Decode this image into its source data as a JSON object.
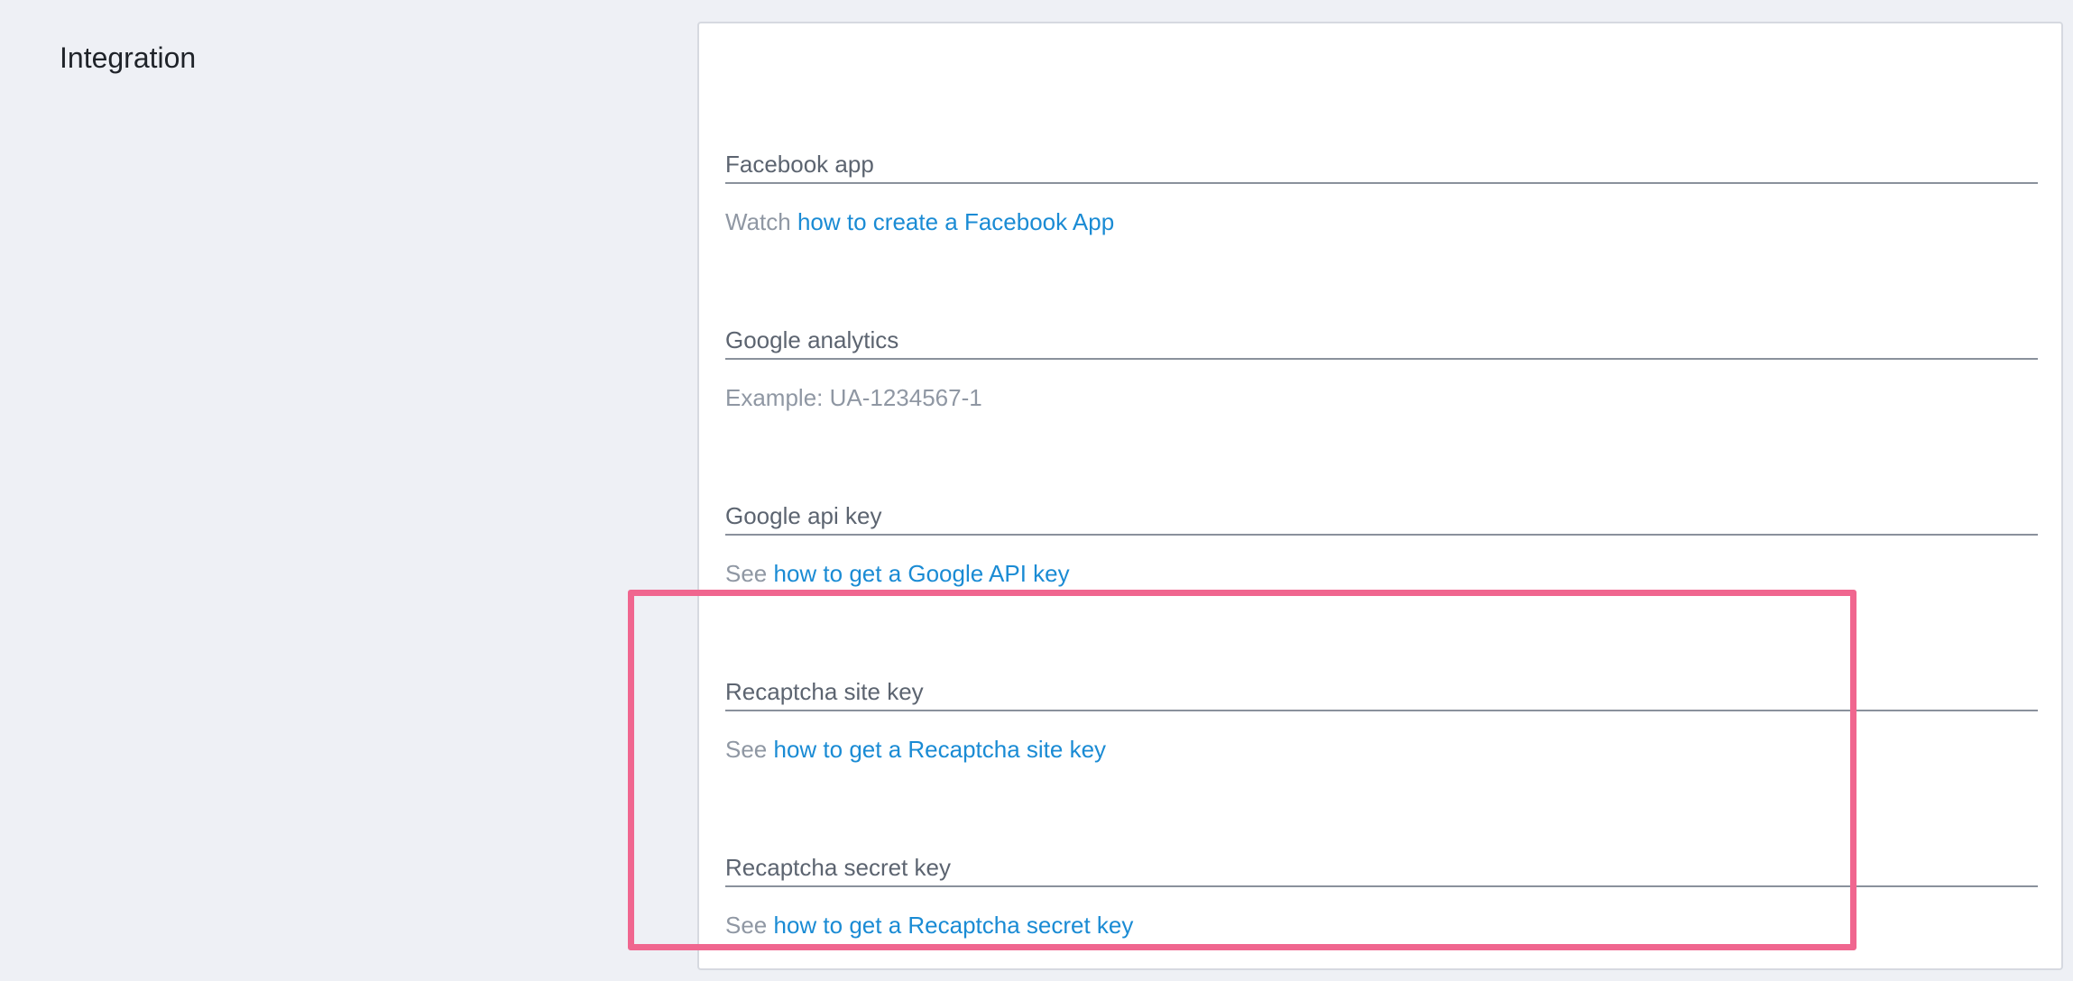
{
  "section": {
    "title": "Integration"
  },
  "fields": [
    {
      "label": "Facebook app",
      "help_prefix": "Watch",
      "help_link": "how to create a Facebook App",
      "placeholder": ""
    },
    {
      "label": "Google analytics",
      "help_text": "Example: UA-1234567-1",
      "placeholder": ""
    },
    {
      "label": "Google api key",
      "help_prefix": "See",
      "help_link": "how to get a Google API key",
      "placeholder": ""
    },
    {
      "label": "Recaptcha site key",
      "help_prefix": "See",
      "help_link": "how to get a Recaptcha site key",
      "placeholder": ""
    },
    {
      "label": "Recaptcha secret key",
      "help_prefix": "See",
      "help_link": "how to get a Recaptcha secret key",
      "placeholder": ""
    }
  ],
  "colors": {
    "background": "#eef0f5",
    "panel": "#ffffff",
    "link": "#1a8bd4",
    "highlight": "#f0668f"
  }
}
